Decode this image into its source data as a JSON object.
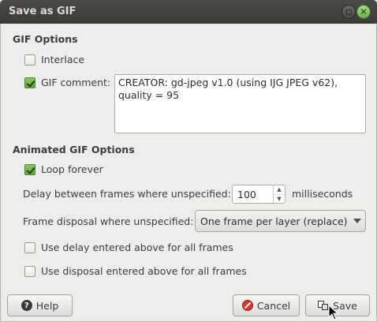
{
  "window": {
    "title": "Save as GIF"
  },
  "gif_options": {
    "section_title": "GIF Options",
    "interlace": {
      "label": "Interlace",
      "checked": false
    },
    "gif_comment": {
      "label": "GIF comment:",
      "checked": true,
      "value": "CREATOR: gd-jpeg v1.0 (using IJG JPEG v62),\nquality = 95"
    }
  },
  "animated_options": {
    "section_title": "Animated GIF Options",
    "loop_forever": {
      "label": "Loop forever",
      "checked": true
    },
    "delay": {
      "label": "Delay between frames where unspecified:",
      "value": "100",
      "unit": "milliseconds"
    },
    "disposal": {
      "label": "Frame disposal where unspecified:",
      "value": "One frame per layer (replace)"
    },
    "use_delay_all": {
      "label": "Use delay entered above for all frames",
      "checked": false
    },
    "use_disposal_all": {
      "label": "Use disposal entered above for all frames",
      "checked": false
    }
  },
  "buttons": {
    "help": "Help",
    "cancel": "Cancel",
    "save": "Save"
  },
  "colors": {
    "accent": "#65a53f",
    "titlebar": "#3b3b39",
    "cancel_icon": "#d23a2a"
  }
}
